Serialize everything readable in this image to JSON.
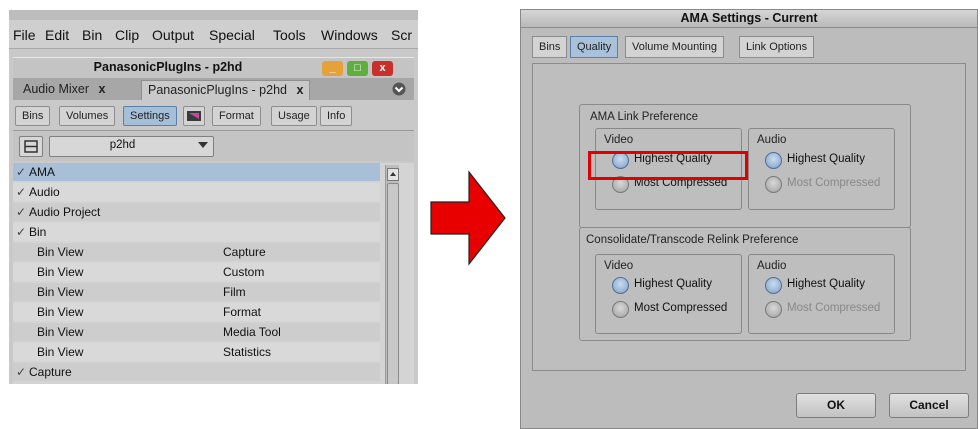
{
  "left_window": {
    "menu": [
      "File",
      "Edit",
      "Bin",
      "Clip",
      "Output",
      "Special",
      "Tools",
      "Windows",
      "Scr"
    ],
    "title": "PanasonicPlugIns - p2hd",
    "window_controls": {
      "minimize": "_",
      "maximize": "□",
      "close": "x"
    },
    "tabs": [
      {
        "label": "Audio Mixer",
        "close": "x"
      },
      {
        "label": "PanasonicPlugIns - p2hd",
        "close": "x"
      }
    ],
    "tab_menu_icon": "circle-chevron-icon",
    "subtabs": [
      "Bins",
      "Volumes",
      "Settings",
      "",
      "Format",
      "Usage",
      "Info"
    ],
    "active_subtab": "Settings",
    "settings_selector": "p2hd",
    "rows": [
      {
        "check": "✓",
        "name": "AMA",
        "value": "",
        "selected": true
      },
      {
        "check": "✓",
        "name": "Audio",
        "value": ""
      },
      {
        "check": "✓",
        "name": "Audio Project",
        "value": ""
      },
      {
        "check": "✓",
        "name": "Bin",
        "value": ""
      },
      {
        "check": "",
        "name": "Bin View",
        "value": "Capture"
      },
      {
        "check": "",
        "name": "Bin View",
        "value": "Custom"
      },
      {
        "check": "",
        "name": "Bin View",
        "value": "Film"
      },
      {
        "check": "",
        "name": "Bin View",
        "value": "Format"
      },
      {
        "check": "",
        "name": "Bin View",
        "value": "Media Tool"
      },
      {
        "check": "",
        "name": "Bin View",
        "value": "Statistics"
      },
      {
        "check": "✓",
        "name": "Capture",
        "value": ""
      }
    ]
  },
  "arrow_color": "#e80000",
  "dialog": {
    "title": "AMA Settings - Current",
    "tabs": [
      "Bins",
      "Quality",
      "Volume Mounting",
      "Link Options"
    ],
    "active_tab": "Quality",
    "link_pref": {
      "title": "AMA Link Preference",
      "video": {
        "title": "Video",
        "opt1": "Highest Quality",
        "opt2": "Most Compressed",
        "selected": "Highest Quality"
      },
      "audio": {
        "title": "Audio",
        "opt1": "Highest Quality",
        "opt2": "Most Compressed",
        "selected": "Highest Quality"
      }
    },
    "relink_pref": {
      "title": "Consolidate/Transcode Relink Preference",
      "video": {
        "title": "Video",
        "opt1": "Highest Quality",
        "opt2": "Most Compressed",
        "selected": "Highest Quality"
      },
      "audio": {
        "title": "Audio",
        "opt1": "Highest Quality",
        "opt2": "Most Compressed",
        "selected": "Highest Quality"
      }
    },
    "ok": "OK",
    "cancel": "Cancel",
    "highlight_color": "#e00000"
  }
}
